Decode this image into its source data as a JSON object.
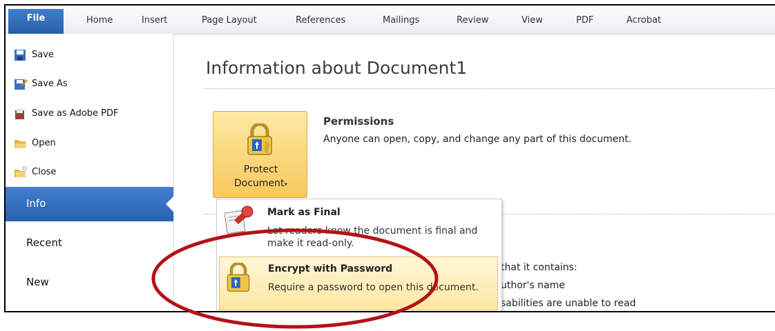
{
  "tabs": [
    {
      "label": "File"
    },
    {
      "label": "Home"
    },
    {
      "label": "Insert"
    },
    {
      "label": "Page Layout"
    },
    {
      "label": "References"
    },
    {
      "label": "Mailings"
    },
    {
      "label": "Review"
    },
    {
      "label": "View"
    },
    {
      "label": "PDF"
    },
    {
      "label": "Acrobat"
    }
  ],
  "sidebar": {
    "items": [
      {
        "label": "Save",
        "icon": "save-icon"
      },
      {
        "label": "Save As",
        "icon": "save-as-icon"
      },
      {
        "label": "Save as Adobe PDF",
        "icon": "adobe-pdf-icon"
      },
      {
        "label": "Open",
        "icon": "open-folder-icon"
      },
      {
        "label": "Close",
        "icon": "close-folder-icon"
      }
    ],
    "sections": [
      {
        "label": "Info",
        "active": true
      },
      {
        "label": "Recent"
      },
      {
        "label": "New"
      }
    ]
  },
  "main": {
    "title": "Information about Document1",
    "protect_button": {
      "line1": "Protect",
      "line2": "Document",
      "caret": "▾"
    },
    "permissions": {
      "title": "Permissions",
      "text": "Anyone can open, copy, and change any part of this document."
    },
    "background_fragments": [
      "that it contains:",
      "uthor's name",
      "sabilities are unable to read"
    ]
  },
  "dropdown": {
    "items": [
      {
        "title": "Mark as Final",
        "desc": "Let readers know the document is final and make it read-only.",
        "icon": "mark-final-icon"
      },
      {
        "title": "Encrypt with Password",
        "desc": "Require a password to open this document.",
        "icon": "lock-icon",
        "highlighted": true
      }
    ]
  },
  "colors": {
    "accent": "#2a62b0",
    "highlight": "#fde7a2",
    "annotation": "#b31217"
  }
}
